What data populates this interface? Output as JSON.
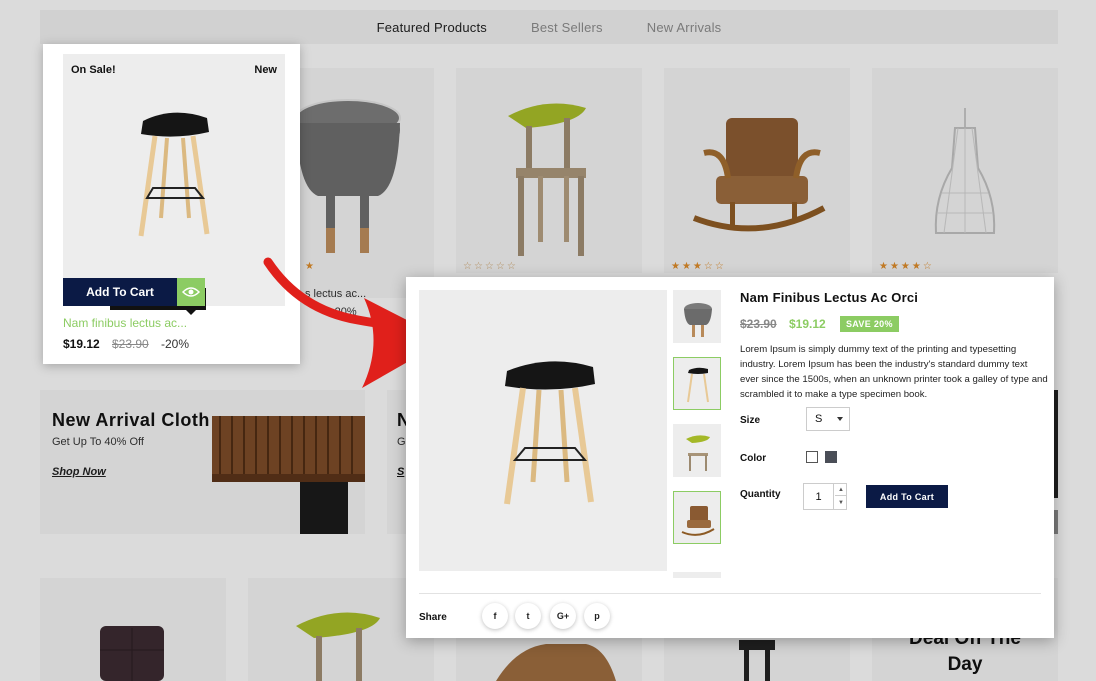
{
  "tabs": [
    {
      "label": "Featured Products",
      "active": true
    },
    {
      "label": "Best Sellers",
      "active": false
    },
    {
      "label": "New Arrivals",
      "active": false
    }
  ],
  "background": {
    "product_name_partial": "s lectus ac...",
    "discount_partial": "-20%",
    "banner": {
      "title": "New Arrival Cloth",
      "subtitle": "Get Up To 40% Off",
      "link": "Shop Now"
    },
    "banner2_initials": {
      "title": "N",
      "sub": "G",
      "link": "S"
    },
    "deal_title_line1": "Deal Off The",
    "deal_title_line2": "Day"
  },
  "hover_card": {
    "badge_sale": "On Sale!",
    "badge_new": "New",
    "quick_view_label": "Quick View",
    "add_to_cart_label": "Add To Cart",
    "name": "Nam finibus lectus ac...",
    "price": "$19.12",
    "old_price": "$23.90",
    "discount": "-20%"
  },
  "modal": {
    "title": "Nam Finibus Lectus Ac Orci",
    "old_price": "$23.90",
    "price": "$19.12",
    "save_badge": "SAVE 20%",
    "description": "Lorem Ipsum is simply dummy text of the printing and typesetting industry. Lorem Ipsum has been the industry's standard dummy text ever since the 1500s, when an unknown printer took a galley of type and scrambled it to make a type specimen book.",
    "size_label": "Size",
    "size_value": "S",
    "color_label": "Color",
    "colors": [
      "#ffffff",
      "#4a4e57"
    ],
    "quantity_label": "Quantity",
    "quantity_value": "1",
    "add_to_cart_label": "Add To Cart",
    "share_label": "Share",
    "social": [
      {
        "name": "facebook-icon",
        "glyph": "f"
      },
      {
        "name": "twitter-icon",
        "glyph": "t"
      },
      {
        "name": "google-plus-icon",
        "glyph": "G+"
      },
      {
        "name": "pinterest-icon",
        "glyph": "p"
      }
    ]
  },
  "colors": {
    "accent_green": "#8ccc63",
    "navy": "#0b1a45",
    "arrow_red": "#e0201b"
  }
}
